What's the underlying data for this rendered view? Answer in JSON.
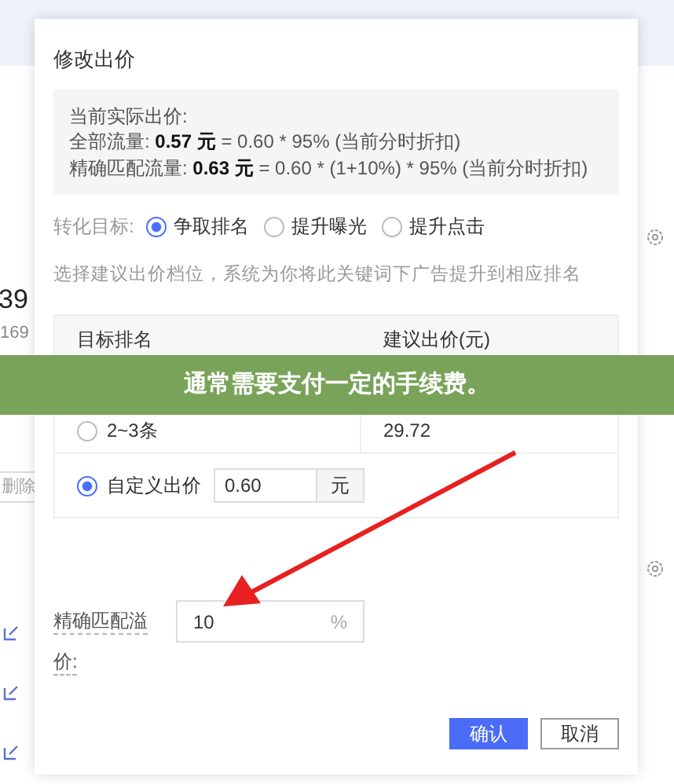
{
  "background": {
    "number": "39",
    "subnumber": "169",
    "delete_button": "删除"
  },
  "dialog": {
    "title": "修改出价",
    "info": {
      "heading": "当前实际出价:",
      "lines": [
        "全部流量: **0.57 元** = 0.60 * 95% (当前分时折扣)",
        "精确匹配流量: **0.63 元** = 0.60 * (1+10%) * 95% (当前分时折扣)"
      ]
    },
    "goal": {
      "label": "转化目标:",
      "options": [
        {
          "label": "争取排名",
          "selected": true
        },
        {
          "label": "提升曝光",
          "selected": false
        },
        {
          "label": "提升点击",
          "selected": false
        }
      ]
    },
    "hint": "选择建议出价档位，系统为你将此关键词下广告提升到相应排名",
    "table": {
      "columns": [
        "目标排名",
        "建议出价(元)"
      ],
      "rows": [
        {
          "rank": "2~3条",
          "price": "29.72",
          "selected": false
        }
      ],
      "custom": {
        "label": "自定义出价",
        "value": "0.60",
        "unit": "元",
        "selected": true
      }
    },
    "premium": {
      "label": "精确匹配溢价:",
      "value": "10",
      "unit": "%"
    },
    "buttons": [
      {
        "label": "确认",
        "kind": "primary"
      },
      {
        "label": "取消",
        "kind": "secondary"
      }
    ]
  },
  "banner": "通常需要支付一定的手续费。"
}
